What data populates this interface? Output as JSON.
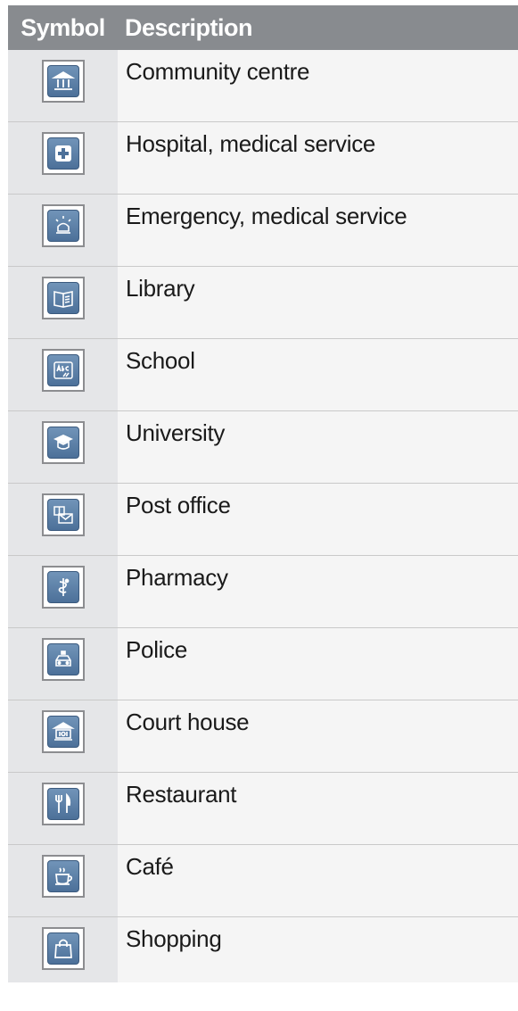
{
  "header": {
    "symbol": "Symbol",
    "description": "Description"
  },
  "rows": [
    {
      "icon": "community-centre-icon",
      "label": "Community centre"
    },
    {
      "icon": "hospital-icon",
      "label": "Hospital, medical service"
    },
    {
      "icon": "emergency-icon",
      "label": "Emergency, medical service"
    },
    {
      "icon": "library-icon",
      "label": "Library"
    },
    {
      "icon": "school-icon",
      "label": "School"
    },
    {
      "icon": "university-icon",
      "label": "University"
    },
    {
      "icon": "post-office-icon",
      "label": "Post office"
    },
    {
      "icon": "pharmacy-icon",
      "label": "Pharmacy"
    },
    {
      "icon": "police-icon",
      "label": "Police"
    },
    {
      "icon": "court-house-icon",
      "label": "Court house"
    },
    {
      "icon": "restaurant-icon",
      "label": "Restaurant"
    },
    {
      "icon": "cafe-icon",
      "label": "Café"
    },
    {
      "icon": "shopping-icon",
      "label": "Shopping"
    }
  ]
}
